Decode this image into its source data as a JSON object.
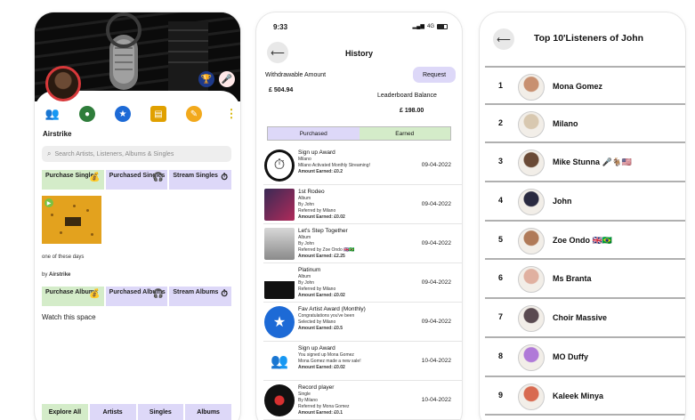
{
  "colors": {
    "green_tab": "#d4ecc9",
    "purple_tab": "#ddd8f8",
    "accent_red": "#e02424",
    "hero_bg": "#0b0b0b"
  },
  "profile": {
    "artist_name": "Airstrike",
    "search_placeholder": "Search Artists, Listeners, Albums & Singles",
    "icons": [
      "users-icon",
      "globe-icon",
      "star-badge-icon",
      "card-icon",
      "edit-icon",
      "more-icon"
    ],
    "singles_segments": [
      {
        "label": "Purchase Singles",
        "icon": "money-bag-icon",
        "glyph": "💰",
        "color": "green"
      },
      {
        "label": "Purchased Singles",
        "icon": "listen-icon",
        "glyph": "🎧",
        "color": "purple"
      },
      {
        "label": "Stream Singles",
        "icon": "stopwatch-icon",
        "glyph": "⏱",
        "color": "purple"
      }
    ],
    "album": {
      "title": "one of these days",
      "by_prefix": "by",
      "by_artist": "Airstrike"
    },
    "album_segments": [
      {
        "label": "Purchase Albums",
        "icon": "money-bag-icon",
        "glyph": "💰",
        "color": "green"
      },
      {
        "label": "Purchased Albums",
        "icon": "listen-icon",
        "glyph": "🎧",
        "color": "purple"
      },
      {
        "label": "Stream Albums",
        "icon": "stopwatch-icon",
        "glyph": "⏱",
        "color": "purple"
      }
    ],
    "watch_text": "Watch this space",
    "bottom_tabs": [
      "Explore All",
      "Artists",
      "Singles",
      "Albums"
    ]
  },
  "history": {
    "status_time": "9:33",
    "status_network": "4G",
    "title": "History",
    "withdrawable_label": "Withdrawable Amount",
    "withdrawable_amount": "£ 504.94",
    "request_label": "Request",
    "leaderboard_label": "Leaderboard Balance",
    "leaderboard_amount": "£ 198.00",
    "toggle": [
      "Purchased",
      "Earned"
    ],
    "items": [
      {
        "title": "Sign up Award",
        "lines": [
          "Milano",
          "Milano Activated Monthly Streaming!"
        ],
        "amount": "Amount Earned: £0.2",
        "date": "09-04-2022",
        "thumb": "stopwatch"
      },
      {
        "title": "1st Rodeo",
        "lines": [
          "Album",
          "By John",
          "Referred by Milano"
        ],
        "amount": "Amount Earned: £0.02",
        "date": "09-04-2022",
        "thumb": "album-dark"
      },
      {
        "title": "Let's Step Together",
        "lines": [
          "Album",
          "By John",
          "Referred by Zoe Ondo 🇬🇧🇧🇷"
        ],
        "amount": "Amount Earned: £2.25",
        "date": "09-04-2022",
        "thumb": "album-grey"
      },
      {
        "title": "Platinum",
        "lines": [
          "Album",
          "By John",
          "Referred by Milano"
        ],
        "amount": "Amount Earned: £0.02",
        "date": "09-04-2022",
        "thumb": "album-bw"
      },
      {
        "title": "Fav Artist Award (Monthly)",
        "lines": [
          "Congratulations you've been",
          "Selected by Milano"
        ],
        "amount": "Amount Earned: £0.5",
        "date": "09-04-2022",
        "thumb": "star"
      },
      {
        "title": "Sign up Award",
        "lines": [
          "You signed up Mona Gomez",
          "Mona Gomez  made a new sale!"
        ],
        "amount": "Amount Earned: £0.02",
        "date": "10-04-2022",
        "thumb": "people"
      },
      {
        "title": "Record player",
        "lines": [
          "Single",
          "By Milano",
          "Referred by Mona Gomez"
        ],
        "amount": "Amount Earned: £0.1",
        "date": "10-04-2022",
        "thumb": "record"
      }
    ]
  },
  "leaderboard": {
    "title": "Top 10'Listeners of John",
    "rows": [
      {
        "rank": "1",
        "name": "Mona Gomez",
        "avatar": "#c89070"
      },
      {
        "rank": "2",
        "name": "Milano",
        "avatar": "#d8c8b0"
      },
      {
        "rank": "3",
        "name": "Mike Stunna 🎤🐐🇺🇸",
        "avatar": "#6a4a36"
      },
      {
        "rank": "4",
        "name": "John",
        "avatar": "#2a2a40"
      },
      {
        "rank": "5",
        "name": "Zoe Ondo 🇬🇧🇧🇷",
        "avatar": "#b07a58"
      },
      {
        "rank": "6",
        "name": "Ms Branta",
        "avatar": "#e0b0a0"
      },
      {
        "rank": "7",
        "name": "Choir Massive",
        "avatar": "#5a4a50"
      },
      {
        "rank": "8",
        "name": "MO Duffy",
        "avatar": "#b07ad8"
      },
      {
        "rank": "9",
        "name": "Kaleek Minya",
        "avatar": "#d86a50"
      }
    ]
  }
}
